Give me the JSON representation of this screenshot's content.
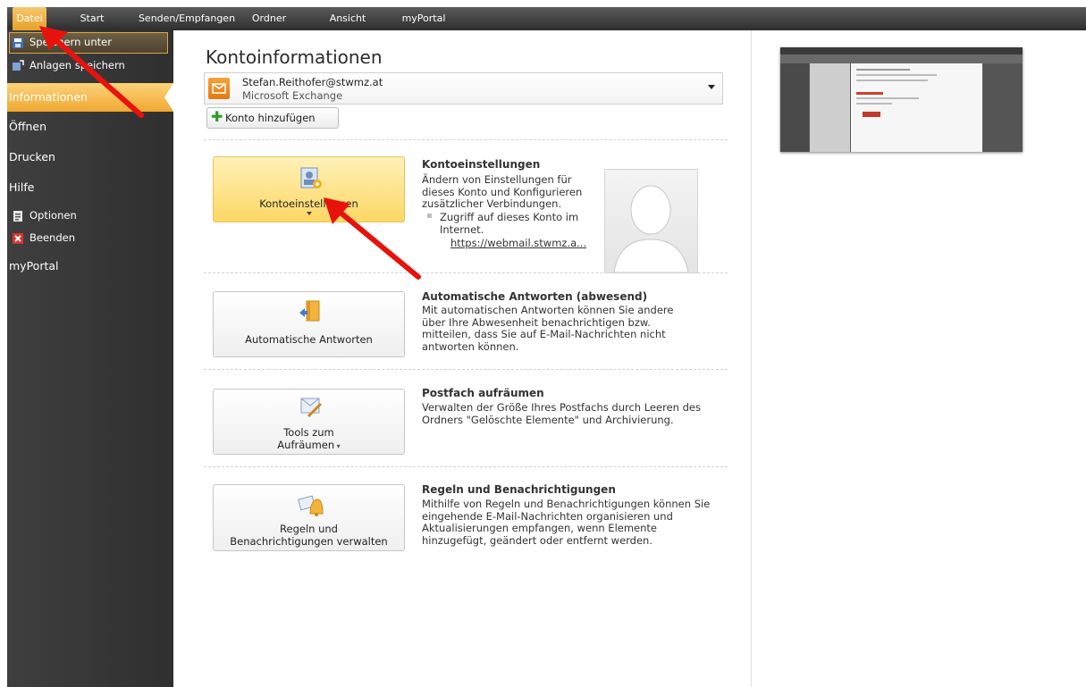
{
  "ribbon": {
    "tabs": [
      "Datei",
      "Start",
      "Senden/Empfangen",
      "Ordner",
      "Ansicht",
      "myPortal"
    ],
    "active_tab": "Datei"
  },
  "nav": {
    "items": [
      {
        "label": "Speichern unter",
        "icon": "save-as-icon"
      },
      {
        "label": "Anlagen speichern",
        "icon": "save-attachments-icon"
      },
      {
        "label": "Informationen",
        "icon": ""
      },
      {
        "label": "Öffnen",
        "icon": ""
      },
      {
        "label": "Drucken",
        "icon": ""
      },
      {
        "label": "Hilfe",
        "icon": ""
      },
      {
        "label": "Optionen",
        "icon": "options-icon"
      },
      {
        "label": "Beenden",
        "icon": "exit-icon"
      },
      {
        "label": "myPortal",
        "icon": ""
      }
    ],
    "active": "Informationen"
  },
  "main": {
    "title": "Kontoinformationen",
    "account": {
      "email": "Stefan.Reithofer@stwmz.at",
      "type": "Microsoft Exchange"
    },
    "add_account_label": "Konto hinzufügen",
    "sections": [
      {
        "button_line1": "Kontoeinstellungen",
        "button_line2": "",
        "heading": "Kontoeinstellungen",
        "text": "Ändern von Einstellungen für dieses Konto und Konfigurieren zusätzlicher Verbindungen.",
        "bullet_text": "Zugriff auf dieses Konto im Internet.",
        "link": "https://webmail.stwmz.a..."
      },
      {
        "button_line1": "Automatische Antworten",
        "button_line2": "",
        "heading": "Automatische Antworten (abwesend)",
        "text": "Mit automatischen Antworten können Sie andere über Ihre Abwesenheit benachrichtigen bzw. mitteilen, dass Sie auf E-Mail-Nachrichten nicht antworten können."
      },
      {
        "button_line1": "Tools zum",
        "button_line2": "Aufräumen",
        "heading": "Postfach aufräumen",
        "text": "Verwalten der Größe Ihres Postfachs durch Leeren des Ordners \"Gelöschte Elemente\" und Archivierung."
      },
      {
        "button_line1": "Regeln und",
        "button_line2": "Benachrichtigungen verwalten",
        "heading": "Regeln und Benachrichtigungen",
        "text": "Mithilfe von Regeln und Benachrichtigungen können Sie eingehende E-Mail-Nachrichten organisieren und Aktualisierungen empfangen, wenn Elemente hinzugefügt, geändert oder entfernt werden."
      }
    ]
  },
  "colors": {
    "accent": "#f0a831",
    "annotation_arrow": "#e8120c"
  }
}
